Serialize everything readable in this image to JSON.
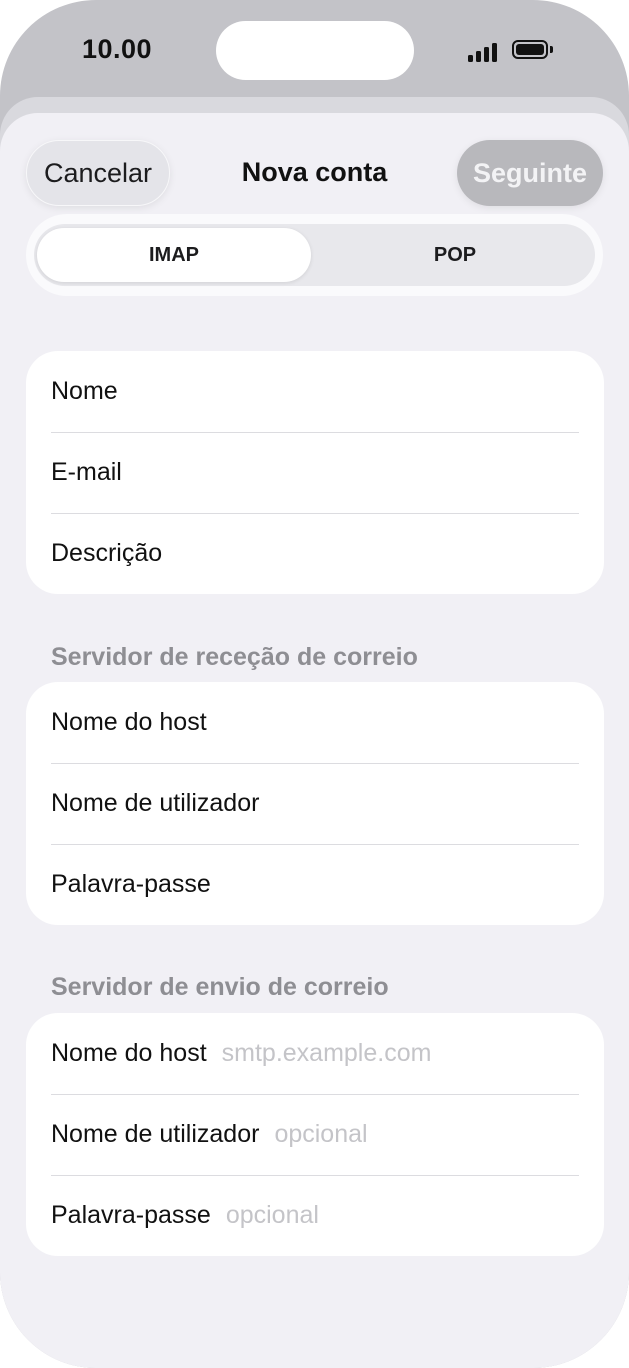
{
  "status_bar": {
    "time": "10.00"
  },
  "nav": {
    "cancel_label": "Cancelar",
    "title": "Nova conta",
    "next_label": "Seguinte"
  },
  "segment": {
    "imap_label": "IMAP",
    "pop_label": "POP",
    "selected": "IMAP"
  },
  "account": {
    "name_label": "Nome",
    "email_label": "E-mail",
    "description_label": "Descrição"
  },
  "incoming": {
    "header": "Servidor de receção de correio",
    "host_label": "Nome do host",
    "username_label": "Nome de utilizador",
    "password_label": "Palavra-passe"
  },
  "outgoing": {
    "header": "Servidor de envio de correio",
    "host_label": "Nome do host",
    "host_placeholder": "smtp.example.com",
    "username_label": "Nome de utilizador",
    "username_placeholder": "opcional",
    "password_label": "Palavra-passe",
    "password_placeholder": "opcional"
  },
  "colors": {
    "sheet_bg": "#f1f0f5",
    "disabled_button": "#b8b8bc",
    "placeholder": "#c4c4c8",
    "section_header": "#8e8e93"
  }
}
